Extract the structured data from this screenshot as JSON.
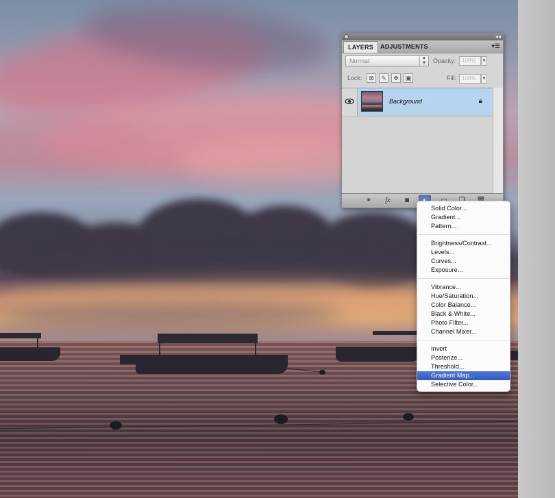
{
  "panel": {
    "tabs": [
      {
        "label": "LAYERS",
        "active": true
      },
      {
        "label": "ADJUSTMENTS",
        "active": false
      }
    ],
    "blend_mode": "Normal",
    "opacity_label": "Opacity:",
    "opacity_value": "100%",
    "lock_label": "Lock:",
    "fill_label": "Fill:",
    "fill_value": "100%",
    "layers": [
      {
        "name": "Background",
        "visible": true,
        "locked": true,
        "selected": true
      }
    ],
    "footer_buttons": [
      "link-layers",
      "add-layer-style",
      "add-mask",
      "new-adjustment-layer",
      "new-group",
      "new-layer",
      "delete-layer"
    ],
    "footer_fx": "fx"
  },
  "menu": {
    "groups": [
      [
        "Solid Color...",
        "Gradient...",
        "Pattern..."
      ],
      [
        "Brightness/Contrast...",
        "Levels...",
        "Curves...",
        "Exposure..."
      ],
      [
        "Vibrance...",
        "Hue/Saturation...",
        "Color Balance...",
        "Black & White...",
        "Photo Filter...",
        "Channel Mixer..."
      ],
      [
        "Invert",
        "Posterize...",
        "Threshold...",
        "Gradient Map...",
        "Selective Color..."
      ]
    ],
    "highlighted": "Gradient Map..."
  },
  "colors": {
    "selected_layer": "#b6d4ef",
    "menu_highlight": "#3a63c9",
    "panel_bg": "#d6d6d6"
  }
}
